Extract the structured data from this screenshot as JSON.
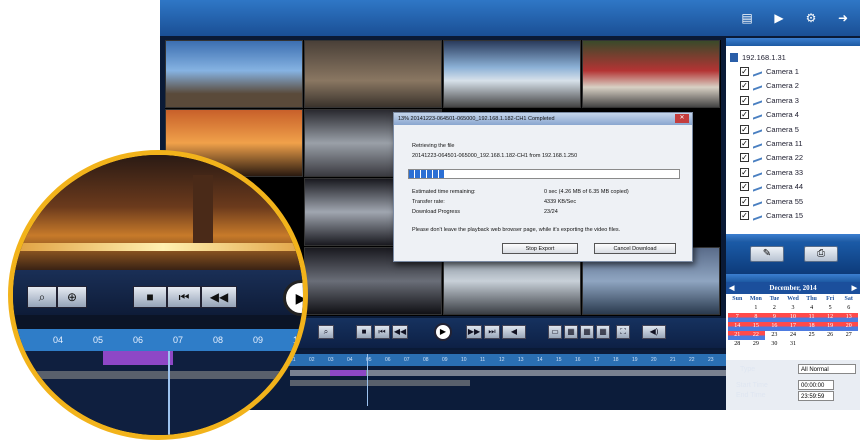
{
  "colors": {
    "accent": "#2f77c6",
    "magnifier_border": "#f2b31b",
    "record_red": "#ff4a4a",
    "record_blue": "#4d7be0"
  },
  "topbar": {
    "icons": [
      "list-icon",
      "play-icon",
      "settings-icon",
      "logout-icon"
    ]
  },
  "device": {
    "ip": "192.168.1.31"
  },
  "cameras": [
    "Camera 1",
    "Camera 2",
    "Camera 3",
    "Camera 4",
    "Camera 5",
    "Camera 11",
    "Camera 22",
    "Camera 33",
    "Camera 44",
    "Camera 55",
    "Camera 15"
  ],
  "calendar": {
    "month": "December, 2014",
    "days_header": [
      "Sun",
      "Mon",
      "Tue",
      "Wed",
      "Thu",
      "Fri",
      "Sat"
    ],
    "rows": [
      [
        "",
        "1",
        "2",
        "3",
        "4",
        "5",
        "6"
      ],
      [
        "7",
        "8",
        "9",
        "10",
        "11",
        "12",
        "13"
      ],
      [
        "14",
        "15",
        "16",
        "17",
        "18",
        "19",
        "20"
      ],
      [
        "21",
        "22",
        "23",
        "24",
        "25",
        "26",
        "27"
      ],
      [
        "28",
        "29",
        "30",
        "31",
        "",
        "",
        ""
      ]
    ]
  },
  "filters": {
    "type_label": "Type",
    "type_value": "All Normal",
    "start_label": "Start Time",
    "start_value": "00:00:00",
    "end_label": "End Time",
    "end_value": "23:59:59"
  },
  "dialog": {
    "title": "13% 20141223-064501-065000_192.168.1.182-CH1 Completed",
    "retrieving": "Retrieving the file",
    "file": "20141223-064501-065000_192.168.1.182-CH1 from 192.168.1.250",
    "remaining_label": "Estimated time remaining:",
    "remaining_value": "0 sec (4.26 MB of 6.35 MB copied)",
    "rate_label": "Transfer rate:",
    "rate_value": "4339 KB/Sec",
    "dl_label": "Download Progress",
    "dl_value": "23/24",
    "note": "Please don't leave the playback web browser page, while it's exporting the video files.",
    "stop_btn": "Stop Export",
    "cancel_btn": "Cancel Download",
    "progress": 0.13
  },
  "timeline": {
    "ticks": [
      "01",
      "02",
      "03",
      "04",
      "05",
      "06",
      "07",
      "08",
      "09",
      "10",
      "11",
      "12",
      "13",
      "14",
      "15",
      "16",
      "17",
      "18",
      "19",
      "20",
      "21",
      "22",
      "23"
    ]
  },
  "magnifier": {
    "ticks": [
      "04",
      "05",
      "06",
      "07",
      "08",
      "09",
      "10"
    ]
  }
}
